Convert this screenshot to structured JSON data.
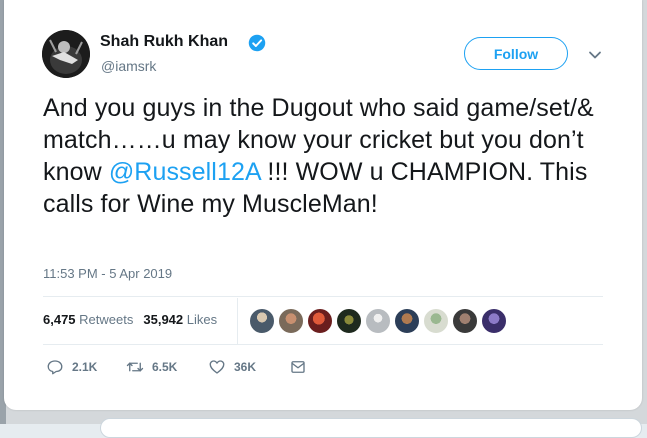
{
  "author": {
    "name": "Shah Rukh Khan",
    "handle": "@iamsrk",
    "verified": true
  },
  "follow_label": "Follow",
  "tweet": {
    "text_before": "And you guys in the Dugout who said game/set/& match……u may know your cricket but you don’t know ",
    "mention": "@Russell12A",
    "text_after": " !!! WOW u CHAMPION. This calls for Wine my MuscleMan!"
  },
  "timestamp": "11:53 PM - 5 Apr 2019",
  "stats": {
    "retweets_count": "6,475",
    "retweets_label": "Retweets",
    "likes_count": "35,942",
    "likes_label": "Likes"
  },
  "liker_avatars": [
    "avatar-1",
    "avatar-2",
    "avatar-3",
    "avatar-4",
    "avatar-5",
    "avatar-6",
    "avatar-7",
    "avatar-8",
    "avatar-9"
  ],
  "actions": {
    "reply_count": "2.1K",
    "retweet_count": "6.5K",
    "like_count": "36K"
  },
  "colors": {
    "accent": "#1da1f2",
    "secondary_text": "#657786",
    "primary_text": "#14171a"
  },
  "icons": [
    "verified-badge-icon",
    "chevron-down-icon",
    "reply-icon",
    "retweet-icon",
    "like-icon",
    "message-icon"
  ]
}
